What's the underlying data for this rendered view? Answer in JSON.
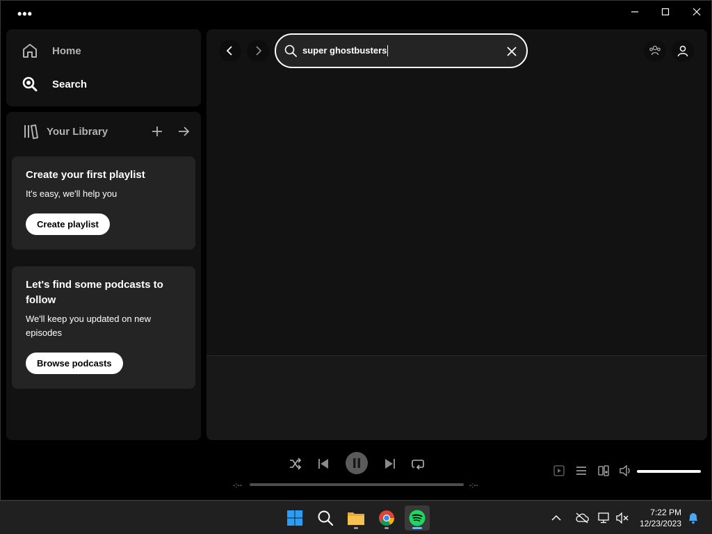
{
  "titlebar": {
    "menu_icon": "ellipsis-icon"
  },
  "nav": {
    "home_label": "Home",
    "search_label": "Search"
  },
  "library": {
    "title": "Your Library",
    "cards": [
      {
        "heading": "Create your first playlist",
        "text": "It's easy, we'll help you",
        "button": "Create playlist"
      },
      {
        "heading": "Let's find some podcasts to follow",
        "text": "We'll keep you updated on new episodes",
        "button": "Browse podcasts"
      }
    ]
  },
  "search": {
    "value": "super ghostbusters"
  },
  "player": {
    "elapsed": "-:--",
    "remaining": "-:--",
    "progress": 0,
    "volume": 1.0
  },
  "taskbar": {
    "time": "7:22 PM",
    "date": "12/23/2023",
    "apps": [
      "windows-start",
      "search",
      "file-explorer",
      "chrome",
      "spotify"
    ]
  },
  "colors": {
    "accent": "#1ed760",
    "panel": "#121212",
    "card": "#242424"
  }
}
